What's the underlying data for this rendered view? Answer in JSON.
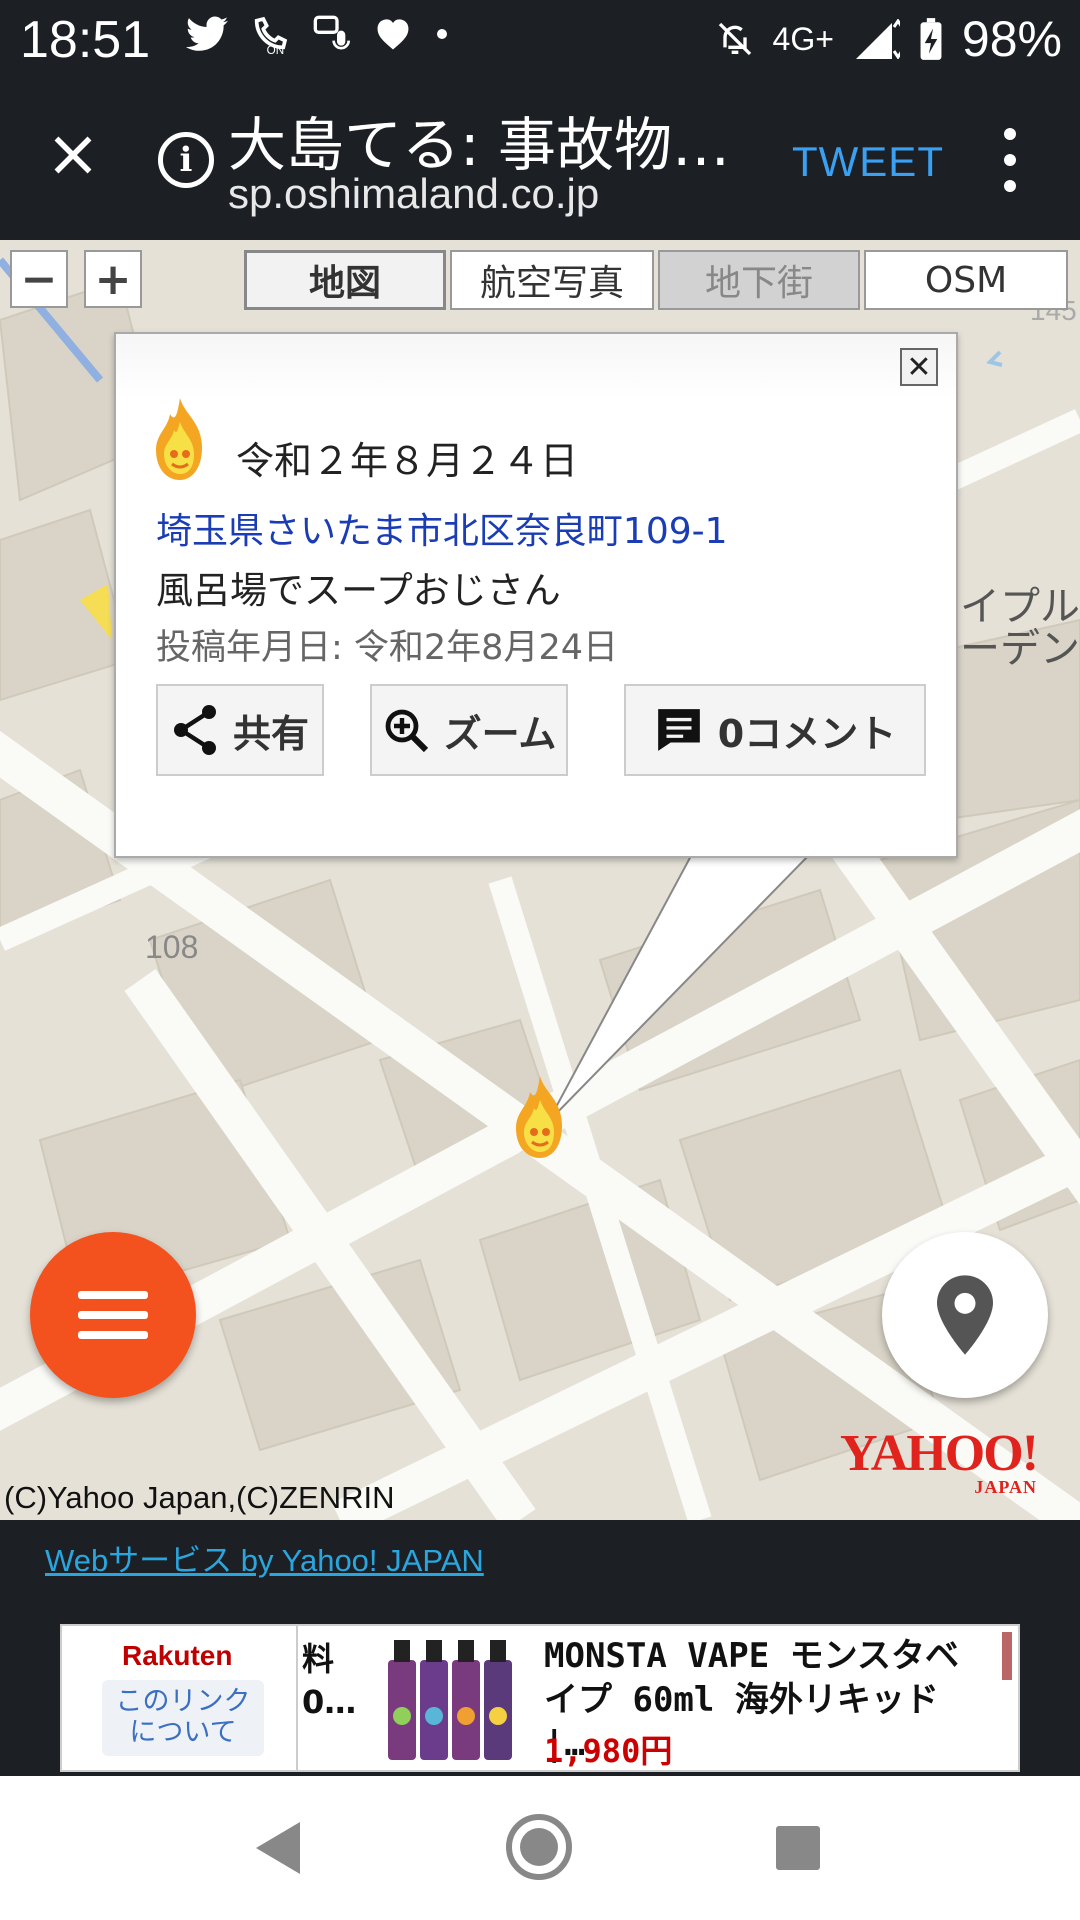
{
  "status_bar": {
    "time": "18:51",
    "network": "4G+",
    "battery": "98%",
    "icons": [
      "twitter-icon",
      "call-on-icon",
      "voice-message-icon",
      "heart-icon",
      "dot-icon",
      "mute-icon",
      "signal-icon",
      "battery-charging-icon"
    ]
  },
  "toolbar": {
    "title": "大島てる: 事故物…",
    "url": "sp.oshimaland.co.jp",
    "tweet_label": "TWEET",
    "close_icon": "close-icon",
    "info_icon": "info-icon",
    "menu_icon": "more-vert-icon"
  },
  "map": {
    "zoom_out": "−",
    "zoom_in": "+",
    "types": [
      {
        "label": "地図",
        "state": "active"
      },
      {
        "label": "航空写真",
        "state": "normal"
      },
      {
        "label": "地下街",
        "state": "disabled"
      },
      {
        "label": "OSM",
        "state": "normal"
      }
    ],
    "labels": {
      "block_number": "108",
      "road_number": "145",
      "place_name_line1": "イプル",
      "place_name_line2": "ーデン"
    },
    "copyright": "(C)Yahoo Japan,(C)ZENRIN",
    "yahoo_logo": "YAHOO!",
    "yahoo_logo_sub": "JAPAN"
  },
  "popup": {
    "close": "✕",
    "date": "令和２年８月２４日",
    "address": "埼玉県さいたま市北区奈良町109-1",
    "description": "風呂場でスープおじさん",
    "posted": "投稿年月日: 令和2年8月24日",
    "share_label": "共有",
    "zoom_label": "ズーム",
    "comment_label": "0コメント"
  },
  "footer": {
    "webservice_link": "Webサービス by Yahoo! JAPAN"
  },
  "ad": {
    "brand": "Rakuten",
    "about_line1": "このリンク",
    "about_line2": "について",
    "partial_line1": "料",
    "partial_line2": "0…",
    "title": "MONSTA VAPE モンスタベイプ 60ml 海外リキッド |…",
    "price": "1,980円"
  },
  "colors": {
    "topbar": "#1c2025",
    "tweet": "#3aa0f2",
    "fab_menu": "#f3511e",
    "address_link": "#1a3db5",
    "map_bg": "#e5e1d7"
  }
}
